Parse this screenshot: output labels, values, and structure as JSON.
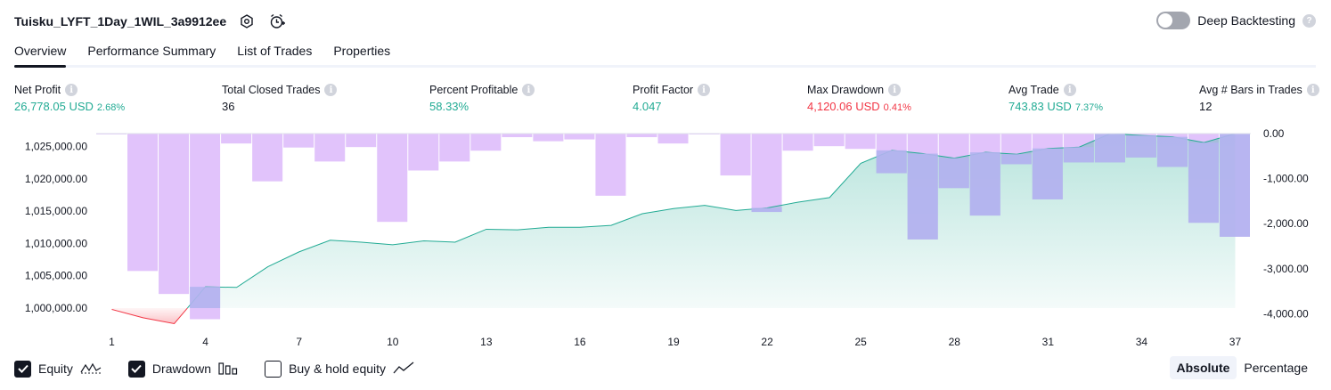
{
  "header": {
    "title": "Tuisku_LYFT_1Day_1WIL_3a9912ee",
    "deep_backtesting_label": "Deep Backtesting",
    "help_glyph": "?"
  },
  "tabs": [
    {
      "label": "Overview",
      "active": true
    },
    {
      "label": "Performance Summary",
      "active": false
    },
    {
      "label": "List of Trades",
      "active": false
    },
    {
      "label": "Properties",
      "active": false
    }
  ],
  "metrics": [
    {
      "label": "Net Profit",
      "value": "26,778.05 USD",
      "sub": "2.68%",
      "color": "#22ab94"
    },
    {
      "label": "Total Closed Trades",
      "value": "36",
      "sub": "",
      "color": "#131722"
    },
    {
      "label": "Percent Profitable",
      "value": "58.33%",
      "sub": "",
      "color": "#22ab94"
    },
    {
      "label": "Profit Factor",
      "value": "4.047",
      "sub": "",
      "color": "#22ab94"
    },
    {
      "label": "Max Drawdown",
      "value": "4,120.06 USD",
      "sub": "0.41%",
      "color": "#f23645"
    },
    {
      "label": "Avg Trade",
      "value": "743.83 USD",
      "sub": "7.37%",
      "color": "#22ab94"
    },
    {
      "label": "Avg # Bars in Trades",
      "value": "12",
      "sub": "",
      "color": "#131722"
    }
  ],
  "info_glyph": "i",
  "chart_data": {
    "type": "area",
    "x_ticks": [
      "1",
      "4",
      "7",
      "10",
      "13",
      "16",
      "19",
      "22",
      "25",
      "28",
      "31",
      "34",
      "37"
    ],
    "left_axis_ticks": [
      "1,025,000.00",
      "1,020,000.00",
      "1,015,000.00",
      "1,010,000.00",
      "1,005,000.00",
      "1,000,000.00"
    ],
    "right_axis_ticks": [
      "0.00",
      "-1,000.00",
      "-2,000.00",
      "-3,000.00",
      "-4,000.00"
    ],
    "initial_capital": 1000000,
    "ylim_equity": [
      997800,
      1027000
    ],
    "ylim_drawdown": [
      -4150,
      0
    ],
    "series": [
      {
        "name": "Equity",
        "color": "#22ab94",
        "values": [
          999800,
          998500,
          997600,
          1003300,
          1003200,
          1006400,
          1008700,
          1010500,
          1010200,
          1009800,
          1010400,
          1010200,
          1012200,
          1012100,
          1012500,
          1012500,
          1012800,
          1014600,
          1015400,
          1015900,
          1015100,
          1015500,
          1016400,
          1017100,
          1022400,
          1024400,
          1023900,
          1023200,
          1024100,
          1023800,
          1024700,
          1024900,
          1027000,
          1026700,
          1026500,
          1025600,
          1027000
        ]
      },
      {
        "name": "Drawdown",
        "color": "#ce93d8",
        "values": [
          -20,
          -3050,
          -3560,
          -4120,
          -220,
          -1060,
          -310,
          -620,
          -300,
          -1960,
          -820,
          -620,
          -380,
          -80,
          -170,
          -130,
          -1380,
          -80,
          -220,
          -20,
          -930,
          -1740,
          -380,
          -280,
          -340,
          -880,
          -2350,
          -1210,
          -1820,
          -680,
          -1460,
          -640,
          -640,
          -530,
          -740,
          -1980,
          -2290
        ]
      }
    ]
  },
  "legend": [
    {
      "label": "Equity",
      "checked": true,
      "icon": "equity-line-icon"
    },
    {
      "label": "Drawdown",
      "checked": true,
      "icon": "drawdown-bars-icon"
    },
    {
      "label": "Buy & hold equity",
      "checked": false,
      "icon": "buy-hold-line-icon"
    }
  ],
  "modes": [
    {
      "label": "Absolute",
      "active": true
    },
    {
      "label": "Percentage",
      "active": false
    }
  ],
  "colors": {
    "equity_line": "#22ab94",
    "equity_loss": "#f23645",
    "drawdown_bar": "#e1c3fb",
    "drawdown_bar_overlap": "#b4b4ef",
    "text": "#131722"
  }
}
